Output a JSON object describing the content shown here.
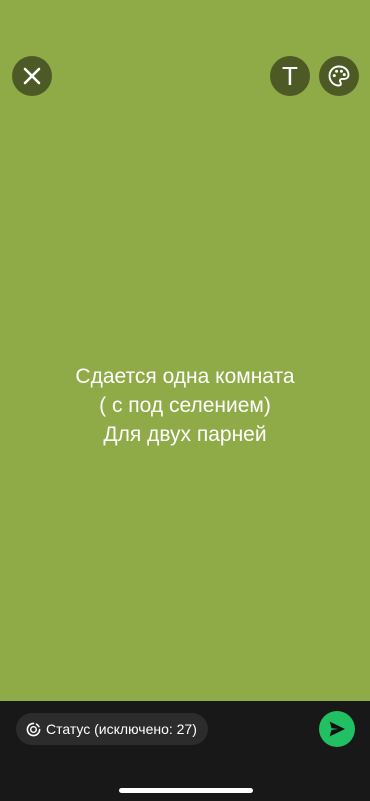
{
  "toolbar": {
    "close_icon": "close-icon",
    "text_tool_glyph": "T",
    "palette_icon": "palette-icon"
  },
  "status": {
    "background_color": "#8fab47",
    "lines": [
      "Сдается одна комната",
      "( с под селением)",
      "Для двух парней"
    ]
  },
  "footer": {
    "audience_icon": "status-ring-icon",
    "audience_label": "Статус (исключено: 27)",
    "send_icon": "send-icon",
    "send_color": "#21c063"
  }
}
